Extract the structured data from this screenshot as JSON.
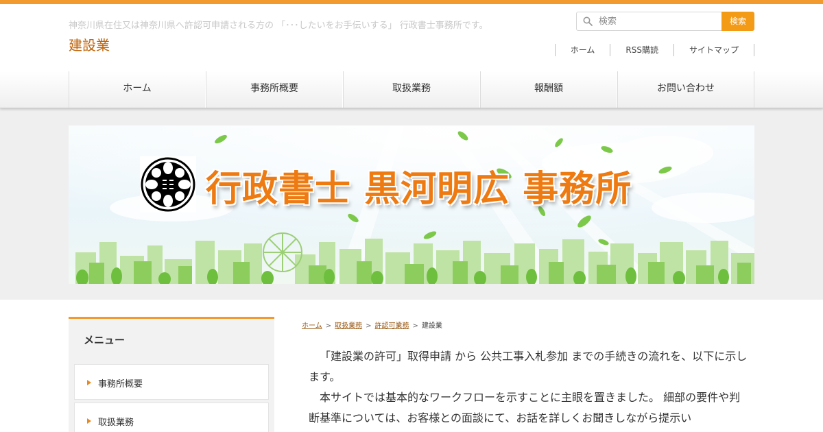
{
  "header": {
    "tagline": "神奈川県在住又は神奈川県へ許認可申請される方の 「･･･したいをお手伝いする」 行政書士事務所です。",
    "site_title": "建設業"
  },
  "search": {
    "placeholder": "検索",
    "button_label": "検索"
  },
  "utility_nav": [
    {
      "label": "ホーム"
    },
    {
      "label": "RSS購読"
    },
    {
      "label": "サイトマップ"
    }
  ],
  "main_nav": [
    {
      "label": "ホーム"
    },
    {
      "label": "事務所概要"
    },
    {
      "label": "取扱業務"
    },
    {
      "label": "報酬額"
    },
    {
      "label": "お問い合わせ"
    }
  ],
  "banner": {
    "title": "行政書士 黒河明広 事務所"
  },
  "sidebar": {
    "title": "メニュー",
    "items": [
      {
        "label": "事務所概要"
      },
      {
        "label": "取扱業務"
      }
    ]
  },
  "breadcrumb": {
    "items": [
      {
        "label": "ホーム"
      },
      {
        "label": "取扱業務"
      },
      {
        "label": "許認可業務"
      }
    ],
    "current": "建設業",
    "separator": ">"
  },
  "content": {
    "paragraphs": [
      "「建設業の許可」取得申請 から 公共工事入札参加 までの手続きの流れを、以下に示します。",
      "本サイトでは基本的なワークフローを示すことに主眼を置きました。 細部の要件や判断基準については、お客様との面談にて、お話を詳しくお聞きしながら提示い"
    ]
  },
  "colors": {
    "accent": "#f39a2e",
    "title": "#c0640a",
    "banner_text": "#ee7a12",
    "link": "#9a5a14"
  }
}
